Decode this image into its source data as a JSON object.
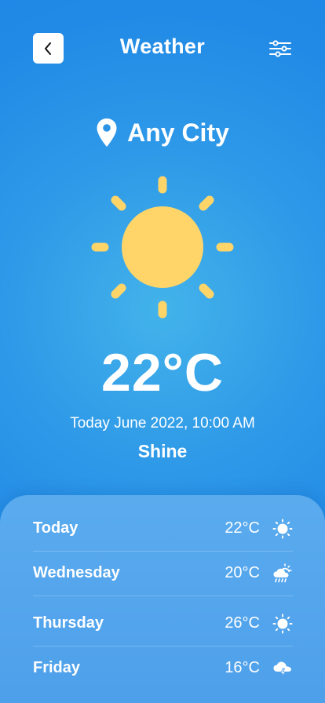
{
  "header": {
    "title": "Weather",
    "back_icon": "chevron-left-icon",
    "settings_icon": "sliders-icon"
  },
  "location": {
    "name": "Any City",
    "icon": "location-pin-icon"
  },
  "current": {
    "icon": "sun-icon",
    "temperature": "22°C",
    "datetime": "Today June 2022, 10:00 AM",
    "condition": "Shine"
  },
  "forecast": [
    {
      "day": "Today",
      "temp": "22°C",
      "icon": "sun-icon"
    },
    {
      "day": "Wednesday",
      "temp": "20°C",
      "icon": "rain-cloud-icon"
    },
    {
      "day": "Thursday",
      "temp": "26°C",
      "icon": "sun-icon"
    },
    {
      "day": "Friday",
      "temp": "16°C",
      "icon": "storm-cloud-icon"
    }
  ],
  "colors": {
    "background": "#218ae6",
    "sun": "#ffd56a",
    "text": "#ffffff",
    "panel": "#55a6ec"
  }
}
